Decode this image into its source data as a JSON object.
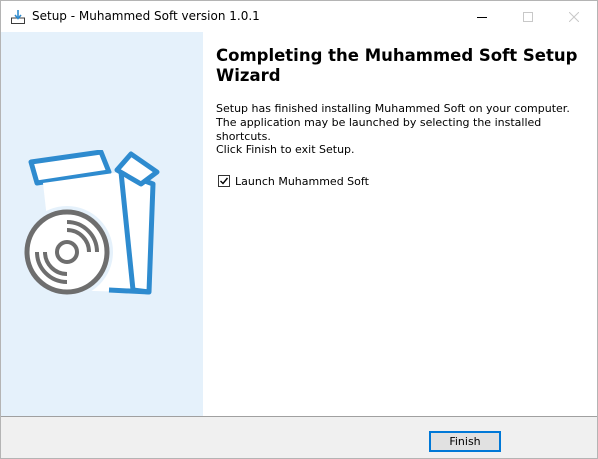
{
  "window": {
    "title": "Setup - Muhammed Soft version 1.0.1",
    "icon": "installer-icon",
    "controls": [
      "minimize-icon",
      "maximize-icon",
      "close-icon"
    ]
  },
  "sidebar": {
    "image": "box-with-disc-illustration",
    "accent_color": "#2e8bcf",
    "disc_color": "#6e6e6e",
    "background": "#e5f1fb"
  },
  "main": {
    "heading": "Completing the Muhammed Soft Setup Wizard",
    "paragraph": "Setup has finished installing Muhammed Soft on your computer. The application may be launched by selecting the installed shortcuts.",
    "instruction": "Click Finish to exit Setup.",
    "launch_checkbox": {
      "label": "Launch Muhammed Soft",
      "checked": true
    }
  },
  "footer": {
    "finish_label": "Finish"
  }
}
